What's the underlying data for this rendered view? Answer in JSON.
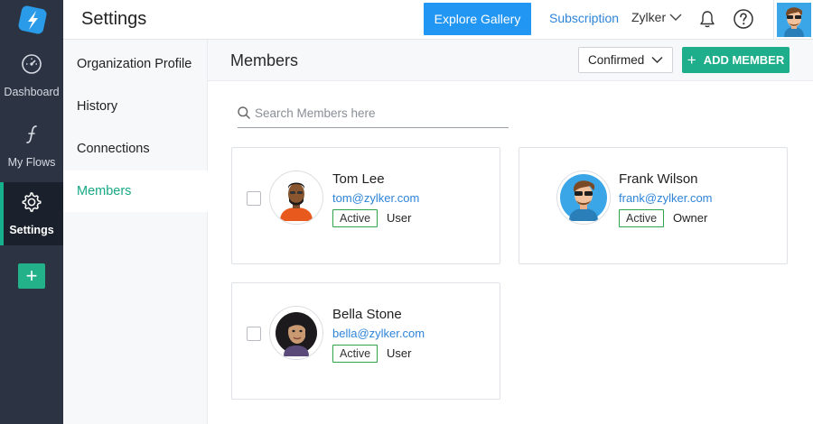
{
  "rail": {
    "items": [
      {
        "label": "Dashboard",
        "icon": "gauge-icon"
      },
      {
        "label": "My Flows",
        "icon": "flow-script-icon"
      },
      {
        "label": "Settings",
        "icon": "gear-icon"
      }
    ],
    "add_icon": "plus-icon"
  },
  "topbar": {
    "title": "Settings",
    "explore_label": "Explore Gallery",
    "subscription_label": "Subscription",
    "org_label": "Zylker"
  },
  "settings_nav": {
    "items": [
      {
        "label": "Organization Profile"
      },
      {
        "label": "History"
      },
      {
        "label": "Connections"
      },
      {
        "label": "Members"
      }
    ],
    "active_index": 3
  },
  "members": {
    "title": "Members",
    "filter_value": "Confirmed",
    "add_label": "ADD MEMBER",
    "search_placeholder": "Search Members here",
    "list": [
      {
        "name": "Tom Lee",
        "email": "tom@zylker.com",
        "status": "Active",
        "role": "User"
      },
      {
        "name": "Frank Wilson",
        "email": "frank@zylker.com",
        "status": "Active",
        "role": "Owner"
      },
      {
        "name": "Bella Stone",
        "email": "bella@zylker.com",
        "status": "Active",
        "role": "User"
      }
    ]
  },
  "colors": {
    "rail_bg": "#2c3444",
    "accent_green": "#1fae8c",
    "primary_blue": "#2196f3",
    "link_blue": "#2f84d8"
  }
}
